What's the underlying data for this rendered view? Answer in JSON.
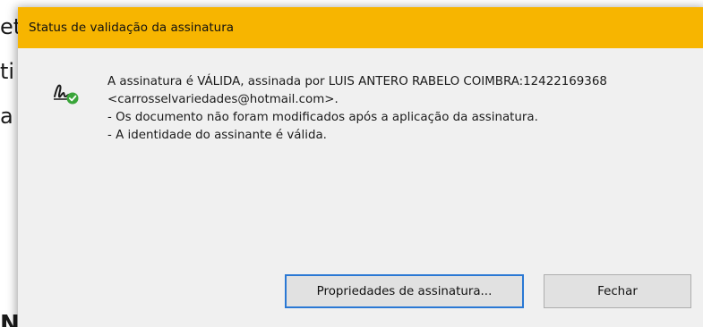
{
  "background": {
    "fragments": [
      "et",
      "ti",
      "a",
      "N"
    ]
  },
  "dialog": {
    "title": "Status de validação da assinatura",
    "title_bar_color": "#f7b500",
    "icon": "signature-valid-icon",
    "message_lines": [
      "A assinatura é VÁLIDA, assinada por LUIS ANTERO RABELO COIMBRA:12422169368",
      "<carrosselvariedades@hotmail.com>.",
      "- Os documento não foram modificados após a aplicação da assinatura.",
      "- A identidade do assinante é válida."
    ],
    "buttons": {
      "properties_label": "Propriedades de assinatura...",
      "close_label": "Fechar"
    }
  }
}
